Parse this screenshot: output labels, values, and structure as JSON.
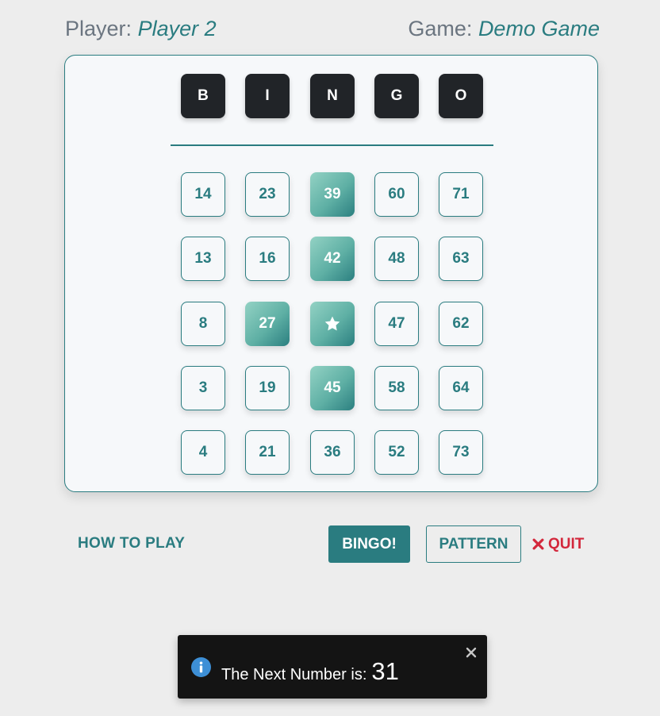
{
  "header": {
    "player_label": "Player:",
    "player_name": "Player 2",
    "game_label": "Game:",
    "game_name": "Demo Game"
  },
  "columns": [
    "B",
    "I",
    "N",
    "G",
    "O"
  ],
  "board": [
    [
      {
        "value": "14",
        "marked": false
      },
      {
        "value": "23",
        "marked": false
      },
      {
        "value": "39",
        "marked": true
      },
      {
        "value": "60",
        "marked": false
      },
      {
        "value": "71",
        "marked": false
      }
    ],
    [
      {
        "value": "13",
        "marked": false
      },
      {
        "value": "16",
        "marked": false
      },
      {
        "value": "42",
        "marked": true
      },
      {
        "value": "48",
        "marked": false
      },
      {
        "value": "63",
        "marked": false
      }
    ],
    [
      {
        "value": "8",
        "marked": false
      },
      {
        "value": "27",
        "marked": true
      },
      {
        "value": "",
        "marked": true,
        "free": true,
        "icon": "star-icon"
      },
      {
        "value": "47",
        "marked": false
      },
      {
        "value": "62",
        "marked": false
      }
    ],
    [
      {
        "value": "3",
        "marked": false
      },
      {
        "value": "19",
        "marked": false
      },
      {
        "value": "45",
        "marked": true
      },
      {
        "value": "58",
        "marked": false
      },
      {
        "value": "64",
        "marked": false
      }
    ],
    [
      {
        "value": "4",
        "marked": false
      },
      {
        "value": "21",
        "marked": false
      },
      {
        "value": "36",
        "marked": false
      },
      {
        "value": "52",
        "marked": false
      },
      {
        "value": "73",
        "marked": false
      }
    ]
  ],
  "actions": {
    "how_to_play": "HOW TO PLAY",
    "bingo": "BINGO!",
    "pattern": "PATTERN",
    "quit": "QUIT",
    "quit_icon": "x-icon"
  },
  "toast": {
    "icon": "info-icon",
    "message": "The Next Number is:",
    "number": "31",
    "close_icon": "close-icon"
  },
  "colors": {
    "accent": "#2a7c80",
    "marked_light": "#93d2c4",
    "letter_bg": "#212428",
    "danger": "#d3283c",
    "toast_bg": "#141414",
    "info": "#3d8fd6"
  }
}
